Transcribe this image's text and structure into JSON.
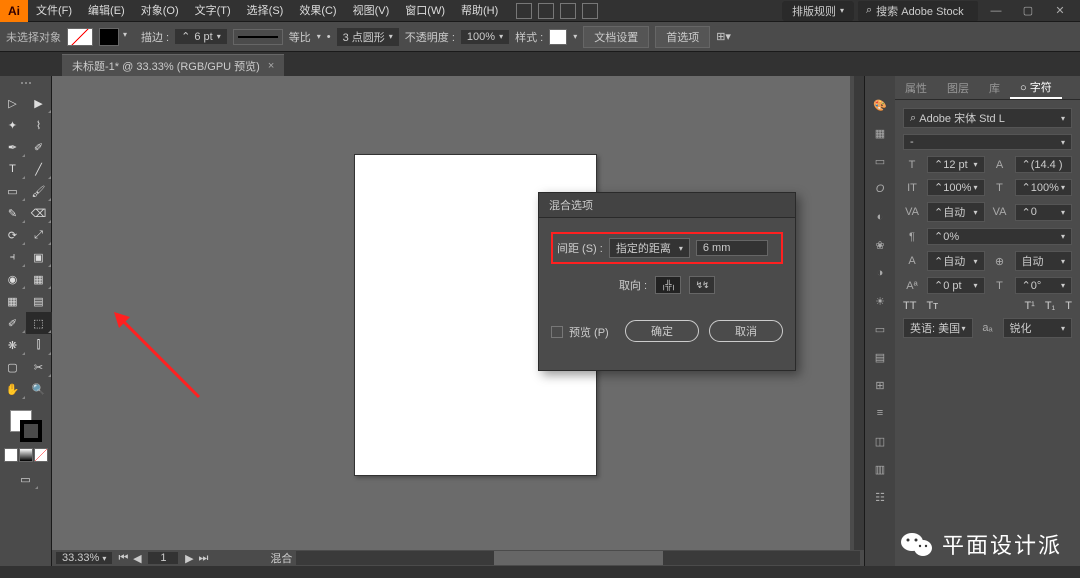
{
  "menu": {
    "items": [
      "文件(F)",
      "编辑(E)",
      "对象(O)",
      "文字(T)",
      "选择(S)",
      "效果(C)",
      "视图(V)",
      "窗口(W)",
      "帮助(H)"
    ],
    "preset": "排版规则",
    "search_placeholder": "搜索 Adobe Stock"
  },
  "ctrl": {
    "noselect": "未选择对象",
    "stroke_label": "描边 :",
    "stroke_val": "6 pt",
    "uniform": "等比",
    "dash": "3 点圆形",
    "opacity_label": "不透明度 :",
    "opacity_val": "100%",
    "style_label": "样式 :",
    "docsetup": "文档设置",
    "prefs": "首选项"
  },
  "tab": {
    "title": "未标题-1* @ 33.33% (RGB/GPU 预览)"
  },
  "dialog": {
    "title": "混合选项",
    "spacing_label": "间距 (S) :",
    "spacing_mode": "指定的距离",
    "spacing_val": "6 mm",
    "orient_label": "取向 :",
    "preview": "预览 (P)",
    "ok": "确定",
    "cancel": "取消"
  },
  "status": {
    "zoom": "33.33%",
    "page": "1",
    "blend": "混合"
  },
  "panel": {
    "tabs": [
      "属性",
      "图层",
      "库",
      "○ 字符"
    ],
    "font": "Adobe 宋体 Std L",
    "weight": "-",
    "size": "12 pt",
    "leading": "(14.4 )",
    "scale_v": "100%",
    "scale_h": "100%",
    "kerning": "自动",
    "tracking": "0",
    "opacity": "0%",
    "auto": "自动",
    "baseline": "0 pt",
    "rotation": "0°",
    "lang": "英语: 美国",
    "aa_pre": "aₐ",
    "aa": "锐化"
  },
  "watermark": "平面设计派"
}
